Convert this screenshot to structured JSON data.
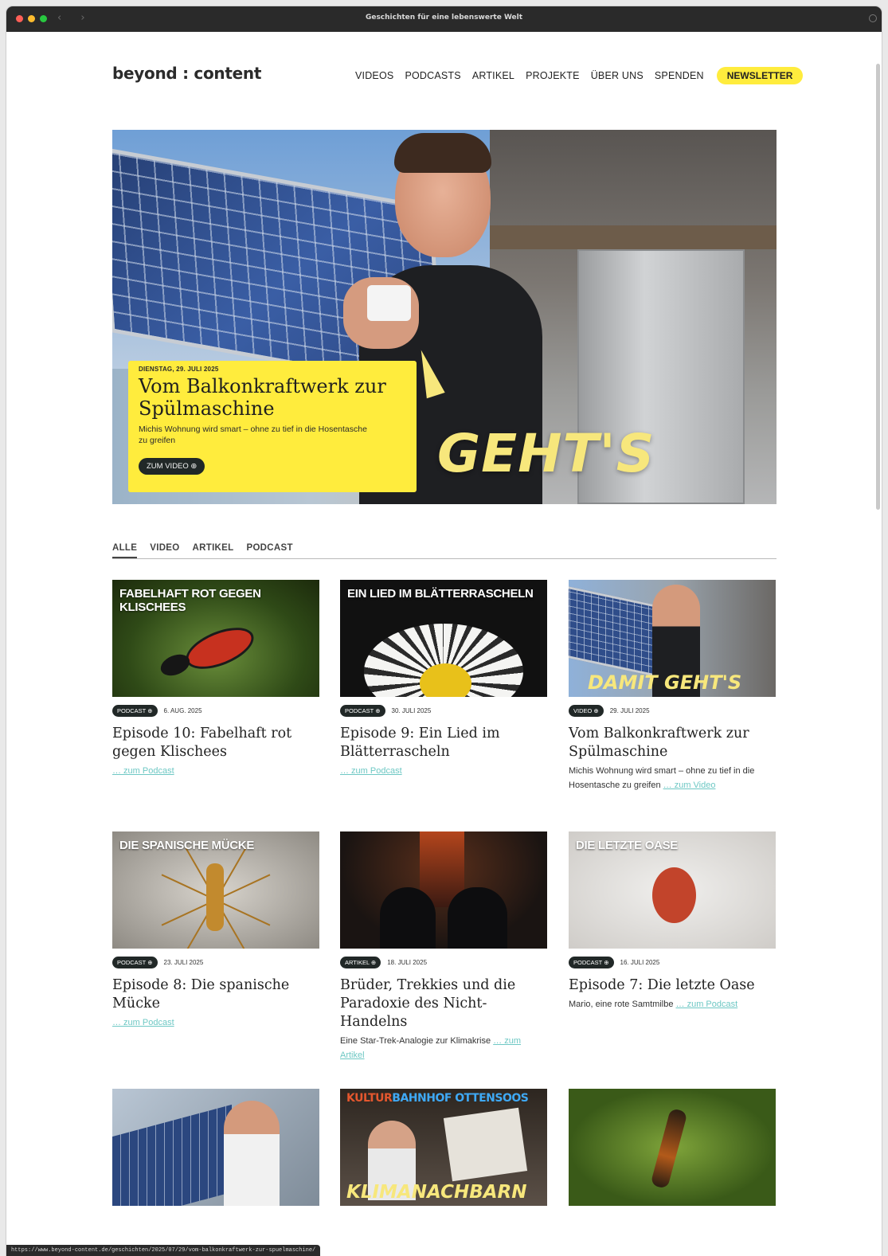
{
  "window": {
    "title": "Geschichten für eine lebenswerte Welt",
    "status_url": "https://www.beyond-content.de/geschichten/2025/07/29/vom-balkonkraftwerk-zur-spuelmaschine/"
  },
  "header": {
    "logo": "beyond : content",
    "nav": [
      "VIDEOS",
      "PODCASTS",
      "ARTIKEL",
      "PROJEKTE",
      "ÜBER UNS",
      "SPENDEN"
    ],
    "newsletter": "NEWSLETTER"
  },
  "hero": {
    "date": "DIENSTAG, 29. JULI 2025",
    "title": "Vom Balkonkraftwerk zur Spülmaschine",
    "teaser": "Michis Wohnung wird smart – ohne zu tief in die Hosentasche zu greifen",
    "button": "ZUM VIDEO ⊕",
    "image_text": "GEHT'S"
  },
  "filters": {
    "items": [
      "ALLE",
      "VIDEO",
      "ARTIKEL",
      "PODCAST"
    ],
    "active": "ALLE"
  },
  "cards": [
    {
      "thumb_text": "FABELHAFT ROT GEGEN KLISCHEES",
      "badge": "PODCAST ⊕",
      "date": "6. AUG. 2025",
      "title": "Episode 10: Fabelhaft rot gegen Klischees",
      "teaser": "",
      "link": "… zum Podcast"
    },
    {
      "thumb_text": "EIN LIED IM BLÄTTERRASCHELN",
      "badge": "PODCAST ⊕",
      "date": "30. JULI 2025",
      "title": "Episode 9: Ein Lied im Blätterrascheln",
      "teaser": "",
      "link": "… zum Podcast"
    },
    {
      "thumb_text": "DAMIT GEHT'S",
      "badge": "VIDEO ⊕",
      "date": "29. JULI 2025",
      "title": "Vom Balkonkraftwerk zur Spülmaschine",
      "teaser": "Michis Wohnung wird smart – ohne zu tief in die Hosentasche zu greifen",
      "link": "… zum Video"
    },
    {
      "thumb_text": "DIE SPANISCHE MÜCKE",
      "badge": "PODCAST ⊕",
      "date": "23. JULI 2025",
      "title": "Episode 8: Die spanische Mücke",
      "teaser": "",
      "link": "… zum Podcast"
    },
    {
      "thumb_text": "",
      "badge": "ARTIKEL ⊕",
      "date": "18. JULI 2025",
      "title": "Brüder, Trekkies und die Paradoxie des Nicht-Handelns",
      "teaser": "Eine Star-Trek-Analogie zur Klimakrise",
      "link": "… zum Artikel"
    },
    {
      "thumb_text": "DIE LETZTE OASE",
      "badge": "PODCAST ⊕",
      "date": "16. JULI 2025",
      "title": "Episode 7: Die letzte Oase",
      "teaser": "Mario, eine rote Samtmilbe",
      "link": "… zum Podcast"
    }
  ],
  "bottom_row": {
    "kultur_a": "KULTUR",
    "kultur_b": "BAHNHOF OTTENSOOS",
    "kultur_c": "KLIMANACHBARN"
  },
  "colors": {
    "accent_yellow": "#ffec3d",
    "badge_dark": "#212827",
    "link_teal": "#6ec8c4"
  }
}
